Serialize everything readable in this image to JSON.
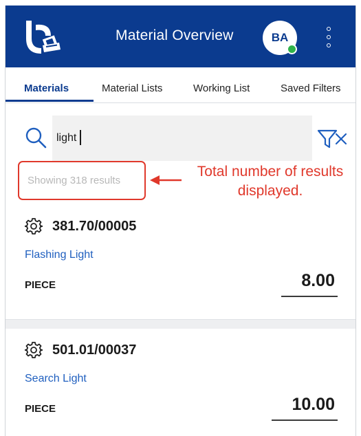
{
  "header": {
    "title": "Material Overview",
    "avatar_initials": "BA",
    "logo_icon": "app-logo-icon",
    "more_icon": "more-vertical-icon",
    "background": "#0b3b8f",
    "presence_color": "#2fb34a"
  },
  "tabs": [
    {
      "label": "Materials",
      "active": true
    },
    {
      "label": "Material Lists",
      "active": false
    },
    {
      "label": "Working List",
      "active": false
    },
    {
      "label": "Saved Filters",
      "active": false
    }
  ],
  "search": {
    "value": "light",
    "placeholder": "",
    "search_icon": "search-icon",
    "clear_icon": "close-icon",
    "filter_icon": "filter-icon"
  },
  "results": {
    "text": "Showing 318 results"
  },
  "annotation": {
    "line1": "Total number of results",
    "line2": "displayed.",
    "color": "#e0382b"
  },
  "materials": [
    {
      "code": "381.70/00005",
      "name": "Flashing Light",
      "unit": "PIECE",
      "quantity": "8.00",
      "icon": "gear-icon"
    },
    {
      "code": "501.01/00037",
      "name": "Search Light",
      "unit": "PIECE",
      "quantity": "10.00",
      "icon": "gear-icon"
    }
  ]
}
